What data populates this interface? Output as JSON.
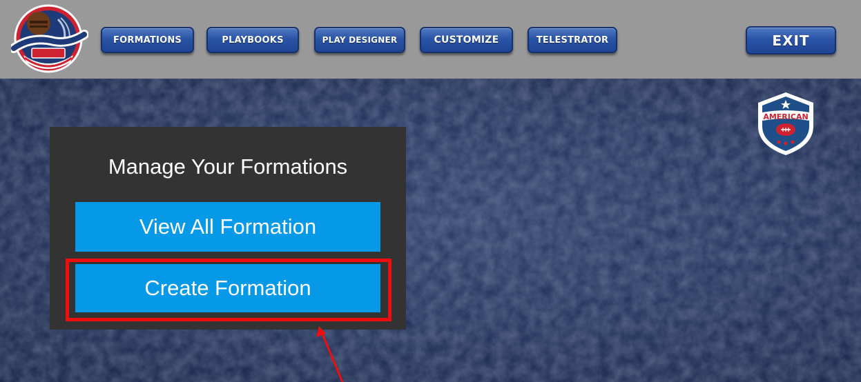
{
  "app": {
    "logo_alt": "Football History",
    "badge_text": "AMERICAN"
  },
  "nav": {
    "formations": "FORMATIONS",
    "playbooks": "PLAYBOOKS",
    "play_designer": "PLAY DESIGNER",
    "customize": "CUSTOMIZE",
    "telestrator": "TELESTRATOR",
    "exit": "EXIT"
  },
  "panel": {
    "title": "Manage Your Formations",
    "view_all": "View All Formation",
    "create": "Create Formation"
  },
  "colors": {
    "topbar": "#999999",
    "nav_button": "#2a54a6",
    "panel": "#333333",
    "action_button": "#0599e8",
    "highlight": "#f00d0d"
  }
}
